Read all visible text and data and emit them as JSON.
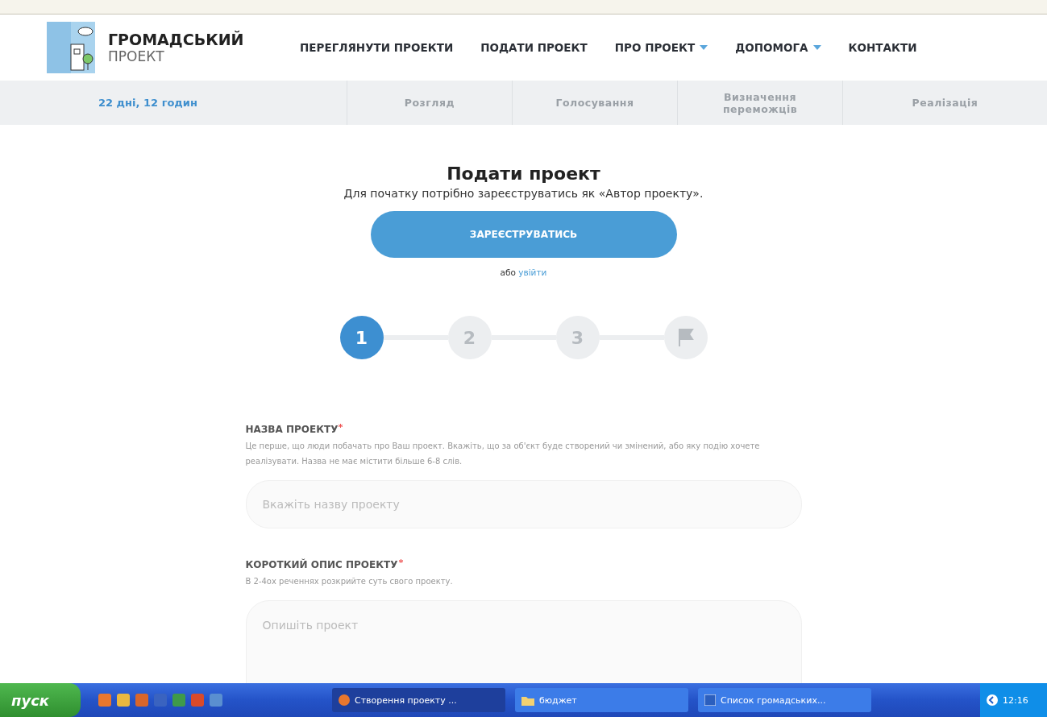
{
  "header": {
    "logo_title": "ГРОМАДСЬКИЙ",
    "logo_subtitle": "ПРОЕКТ",
    "nav": [
      {
        "label": "ПЕРЕГЛЯНУТИ ПРОЕКТИ",
        "dropdown": false
      },
      {
        "label": "ПОДАТИ ПРОЕКТ",
        "dropdown": false
      },
      {
        "label": "ПРО ПРОЕКТ",
        "dropdown": true
      },
      {
        "label": "ДОПОМОГА",
        "dropdown": true
      },
      {
        "label": "КОНТАКТИ",
        "dropdown": false
      }
    ]
  },
  "phases": {
    "countdown": "22 дні, 12 годин",
    "items": [
      "Розгляд",
      "Голосування",
      "Визначення переможців",
      "Реалізація"
    ]
  },
  "main": {
    "title": "Подати проект",
    "subtitle": "Для початку потрібно зареєструватись як «Автор проекту».",
    "register_button": "ЗАРЕЄСТРУВАТИСЬ",
    "alt_text": "або",
    "login_link": "увійти",
    "steps": [
      {
        "kind": "number",
        "label": "1",
        "selected": true
      },
      {
        "kind": "number",
        "label": "2",
        "selected": false
      },
      {
        "kind": "number",
        "label": "3",
        "selected": false
      },
      {
        "kind": "flag",
        "selected": false
      }
    ],
    "fields": [
      {
        "kind": "input",
        "label": "НАЗВА ПРОЕКТУ",
        "required": true,
        "hint": "Це перше, що люди побачать про Ваш проект. Вкажіть, що за об'єкт буде створений чи змінений, або яку подію хочете реалізувати. Назва не має містити більше 6-8 слів.",
        "placeholder": "Вкажіть назву проекту"
      },
      {
        "kind": "textarea",
        "label": "КОРОТКИЙ ОПИС ПРОЕКТУ",
        "required": true,
        "hint": "В 2-4ох реченнях розкрийте суть свого проекту.",
        "placeholder": "Опишіть проект"
      }
    ]
  },
  "taskbar": {
    "start": "пуск",
    "tasks": [
      {
        "kind": "browser",
        "label": "Створення проекту ...",
        "selected": true
      },
      {
        "kind": "folder",
        "label": "бюджет",
        "selected": false
      },
      {
        "kind": "document",
        "label": "Список громадських...",
        "selected": false
      }
    ],
    "clock": "12:16"
  }
}
